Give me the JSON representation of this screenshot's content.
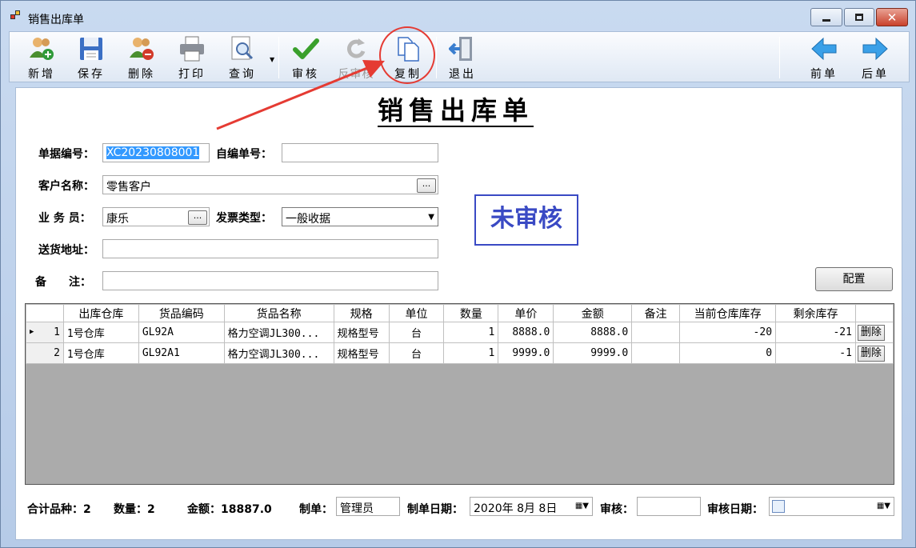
{
  "window": {
    "title": "销售出库单"
  },
  "toolbar": {
    "new": "新增",
    "save": "保存",
    "delete": "删除",
    "print": "打印",
    "query": "查询",
    "approve": "审核",
    "unapprove": "反审核",
    "copy": "复制",
    "exit": "退出",
    "prev": "前单",
    "next": "后单"
  },
  "colors": {
    "title_blue": "#3a4ac4",
    "annotation_red": "#e53b33",
    "selection": "#3399ff"
  },
  "form": {
    "title": "销售出库单",
    "doc_no_label": "单据编号：",
    "doc_no": "XC20230808001",
    "self_no_label": "自编单号：",
    "self_no": "",
    "customer_label": "客户名称：",
    "customer": "零售客户",
    "salesman_label": "业 务 员：",
    "salesman": "康乐",
    "invoice_label": "发票类型：",
    "invoice": "一般收据",
    "address_label": "送货地址：",
    "address": "",
    "remark_label": "备　　注：",
    "remark": "",
    "status": "未审核",
    "config_button": "配置",
    "ellipsis": "..."
  },
  "grid": {
    "headers": [
      "出库仓库",
      "货品编码",
      "货品名称",
      "规格",
      "单位",
      "数量",
      "单价",
      "金额",
      "备注",
      "当前仓库库存",
      "剩余库存"
    ],
    "rows": [
      {
        "no": "1",
        "warehouse": "1号仓库",
        "code": "GL92A",
        "name": "格力空调JL300...",
        "spec": "规格型号",
        "unit": "台",
        "qty": "1",
        "price": "8888.0",
        "amount": "8888.0",
        "note": "",
        "stock": "-20",
        "remain": "-21",
        "action": "删除"
      },
      {
        "no": "2",
        "warehouse": "1号仓库",
        "code": "GL92A1",
        "name": "格力空调JL300...",
        "spec": "规格型号",
        "unit": "台",
        "qty": "1",
        "price": "9999.0",
        "amount": "9999.0",
        "note": "",
        "stock": "0",
        "remain": "-1",
        "action": "删除"
      }
    ]
  },
  "footer": {
    "kinds_label": "合计品种：",
    "kinds": "2",
    "qty_label": "数量：",
    "qty": "2",
    "amount_label": "金额：",
    "amount": "18887.0",
    "maker_label": "制单：",
    "maker": "管理员",
    "make_date_label": "制单日期：",
    "make_date": "2020年  8月  8日",
    "approver_label": "审核：",
    "approver": "",
    "approve_date_label": "审核日期：",
    "approve_date": ""
  }
}
